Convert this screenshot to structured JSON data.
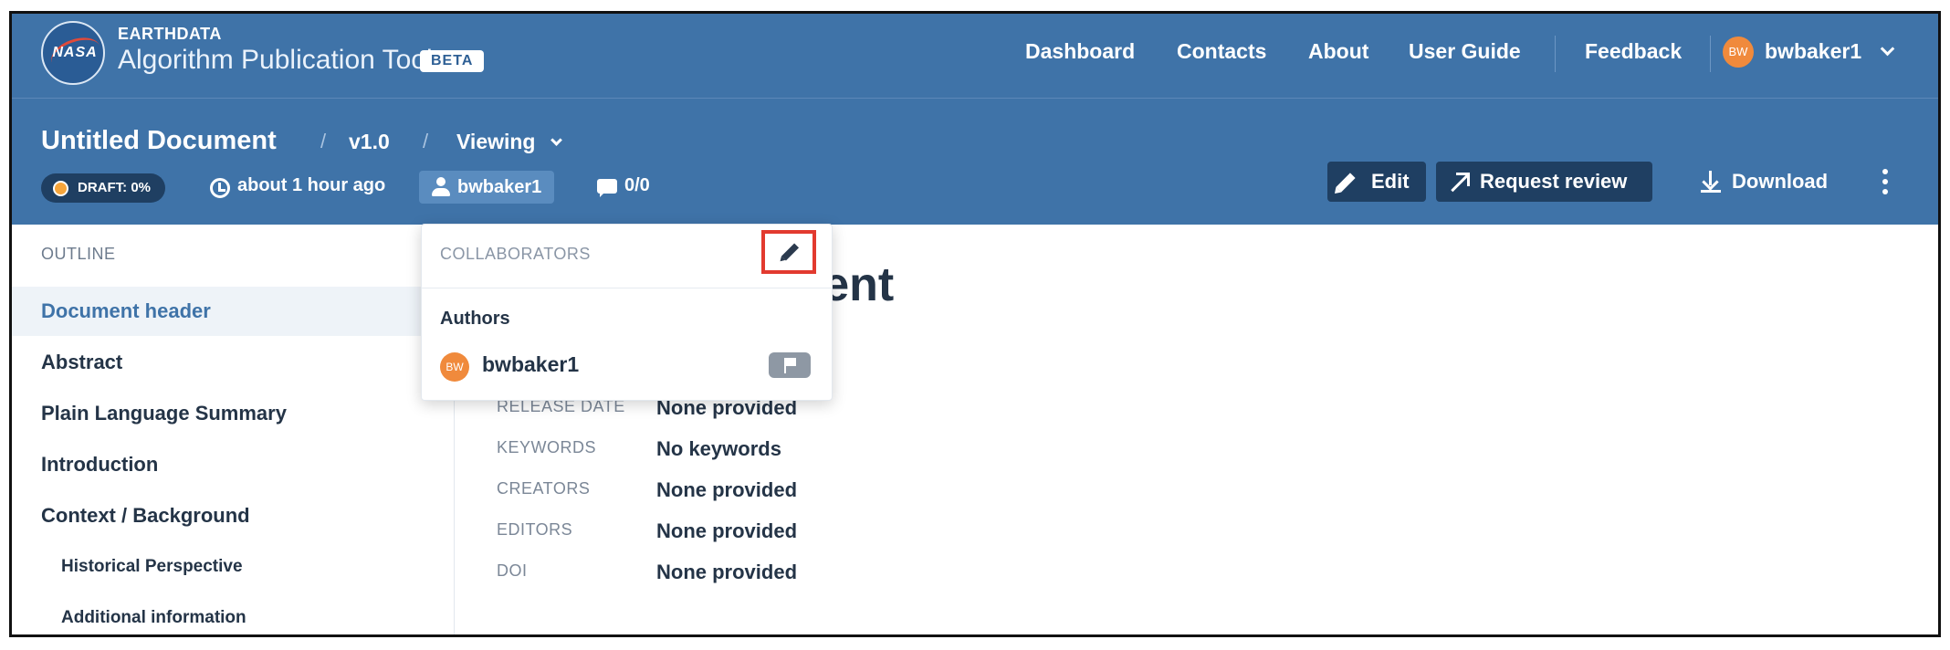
{
  "app": {
    "logo_text": "NASA",
    "brand_top": "EARTHDATA",
    "brand_main": "Algorithm Publication Tool",
    "badge": "BETA"
  },
  "nav": {
    "dashboard": "Dashboard",
    "contacts": "Contacts",
    "about": "About",
    "user_guide": "User Guide",
    "feedback": "Feedback",
    "user_initials": "BW",
    "username": "bwbaker1"
  },
  "document": {
    "title": "Untitled Document",
    "separator": "/",
    "version": "v1.0",
    "mode": "Viewing",
    "status": "DRAFT: 0%",
    "updated": "about 1 hour ago",
    "owner": "bwbaker1",
    "comments": "0/0"
  },
  "actions": {
    "edit": "Edit",
    "request_review": "Request review",
    "download": "Download"
  },
  "outline": {
    "heading": "OUTLINE",
    "items": [
      "Document header",
      "Abstract",
      "Plain Language Summary",
      "Introduction",
      "Context / Background",
      "Historical Perspective",
      "Additional information"
    ]
  },
  "content": {
    "title_fragment": "ment",
    "fields": [
      {
        "label": "RELEASE DATE",
        "value": "None provided"
      },
      {
        "label": "KEYWORDS",
        "value": "No keywords"
      },
      {
        "label": "CREATORS",
        "value": "None provided"
      },
      {
        "label": "EDITORS",
        "value": "None provided"
      },
      {
        "label": "DOI",
        "value": "None provided"
      }
    ]
  },
  "collaborators": {
    "heading": "COLLABORATORS",
    "section": "Authors",
    "user_initials": "BW",
    "username": "bwbaker1"
  },
  "colors": {
    "header_bg": "#3f73a8",
    "button_bg": "#1f3f62",
    "avatar": "#f08a3c",
    "highlight": "#e23a2f"
  }
}
